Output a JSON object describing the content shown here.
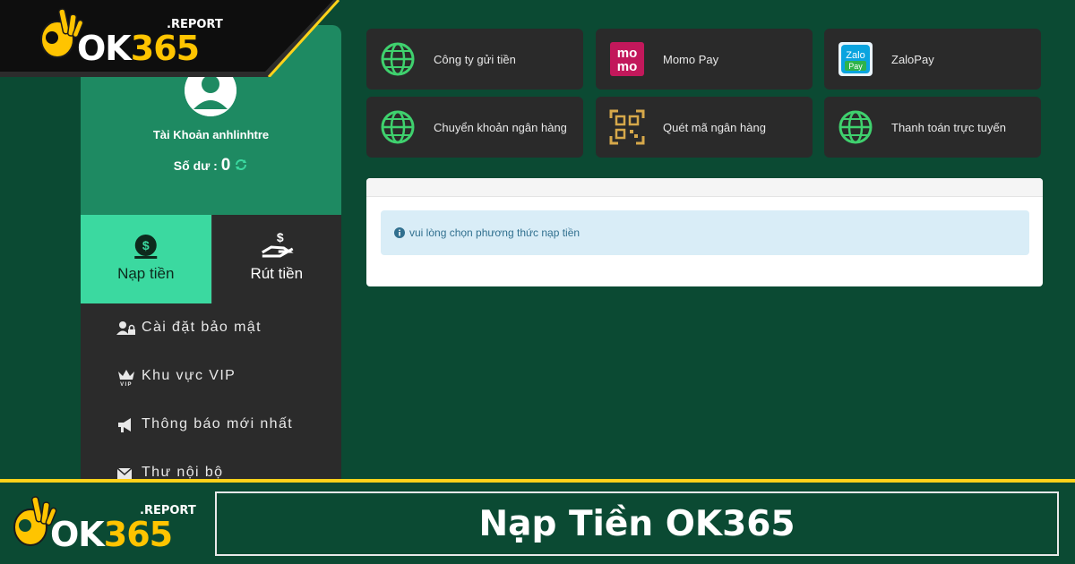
{
  "brand": {
    "logo_main": "OK365",
    "logo_suffix": ".REPORT",
    "colors": {
      "green_dark": "#0b4a33",
      "green_profile": "#1e8a62",
      "mint": "#3bd9a0",
      "yellow": "#ffd21a",
      "card": "#2a2a2a"
    }
  },
  "account": {
    "name": "Tài Khoản anhlinhtre",
    "balance_label": "Số dư :",
    "balance_value": "0",
    "refresh_icon": "refresh-icon"
  },
  "tabs": [
    {
      "label": "Nạp tiền",
      "icon": "money-bag-icon",
      "active": true
    },
    {
      "label": "Rút tiền",
      "icon": "hand-dollar-icon",
      "active": false
    }
  ],
  "menu": [
    {
      "label": "Cài đặt bảo mật",
      "icon": "user-lock-icon"
    },
    {
      "label": "Khu vực VIP",
      "icon": "vip-crown-icon"
    },
    {
      "label": "Thông báo mới nhất",
      "icon": "megaphone-icon"
    },
    {
      "label": "Thư nội bộ",
      "icon": "envelope-icon"
    }
  ],
  "methods": [
    {
      "label": "Công ty gửi tiền",
      "icon": "globe-icon"
    },
    {
      "label": "Momo Pay",
      "icon": "momo-icon",
      "icon_text_1": "mo",
      "icon_text_2": "mo"
    },
    {
      "label": "ZaloPay",
      "icon": "zalopay-icon",
      "icon_text_1": "Zalo",
      "icon_text_2": "Pay"
    },
    {
      "label": "Chuyển khoản ngân hàng",
      "icon": "globe-icon"
    },
    {
      "label": "Quét mã ngân hàng",
      "icon": "qr-code-icon"
    },
    {
      "label": "Thanh toán trực tuyến",
      "icon": "globe-icon"
    }
  ],
  "notice": {
    "text": "vui lòng chọn phương thức nạp tiền",
    "icon": "info-circle-icon"
  },
  "banner": {
    "title": "Nạp Tiền OK365"
  }
}
